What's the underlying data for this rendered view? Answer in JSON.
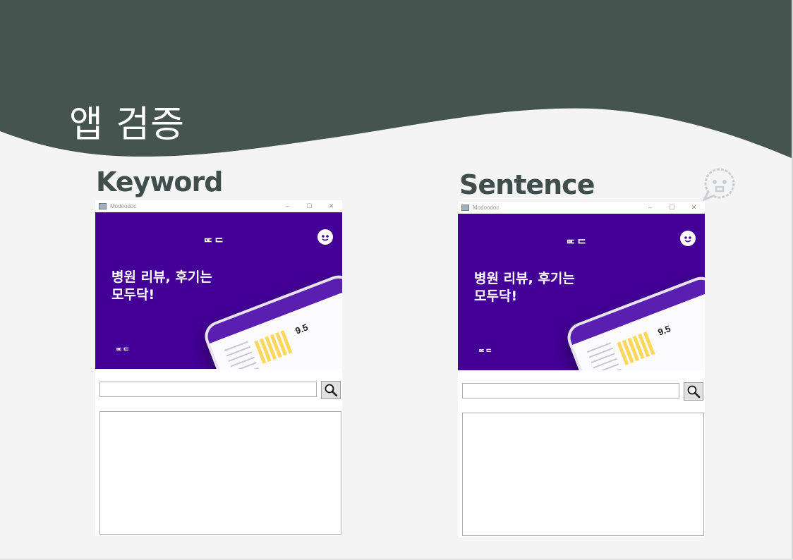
{
  "slide": {
    "title": "앱 검증",
    "colors": {
      "header": "#45544f",
      "background": "#f4f4f4",
      "label": "#3f4e4a",
      "banner": "#440096"
    },
    "decor_icon": "speech-bubble-icon"
  },
  "panels": [
    {
      "label": "Keyword",
      "window_title": "Modoodoc",
      "controls": {
        "minimize": "–",
        "maximize": "☐",
        "close": "✕"
      },
      "banner": {
        "logo": "ᄆᄃᄃ",
        "headline_line1": "병원 리뷰, 후기는",
        "headline_line2": "모두닥!",
        "logo_small": "ᄆᄃᄃ",
        "phone_score": "9.5"
      },
      "search": {
        "value": "",
        "placeholder": "",
        "icon": "magnifier-icon"
      },
      "results": []
    },
    {
      "label": "Sentence",
      "window_title": "Modoodoc",
      "controls": {
        "minimize": "–",
        "maximize": "☐",
        "close": "✕"
      },
      "banner": {
        "logo": "ᄆᄃᄃ",
        "headline_line1": "병원 리뷰, 후기는",
        "headline_line2": "모두닥!",
        "logo_small": "ᄆᄃᄃ",
        "phone_score": "9.5"
      },
      "search": {
        "value": "",
        "placeholder": "",
        "icon": "magnifier-icon"
      },
      "results": []
    }
  ]
}
